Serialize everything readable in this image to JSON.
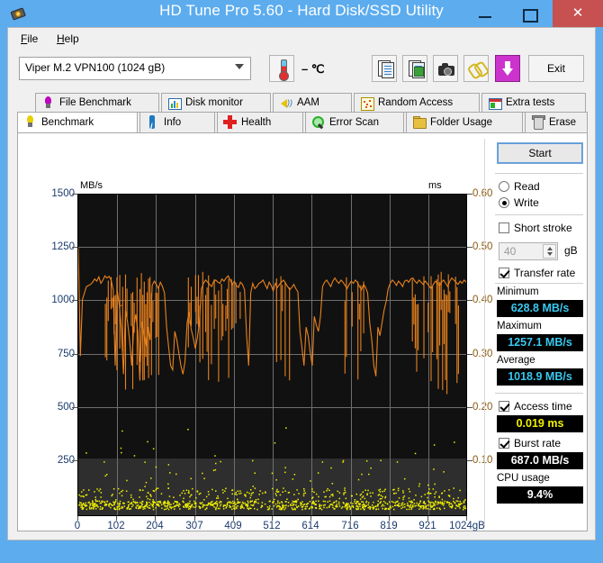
{
  "window": {
    "title": "HD Tune Pro 5.60 - Hard Disk/SSD Utility",
    "app_icon": "hard-disk-icon",
    "minimize": "–",
    "maximize": "▢",
    "close": "✕",
    "titlebar_color": "#5cacee",
    "close_color": "#c75050"
  },
  "menu": {
    "items": [
      {
        "label": "File",
        "accel": "F"
      },
      {
        "label": "Help",
        "accel": "H"
      }
    ]
  },
  "toolbar": {
    "drive": "Viper M.2 VPN100 (1024 gB)",
    "temperature": "– ℃",
    "thermometer_icon": "thermometer-icon",
    "buttons": [
      {
        "name": "copy-text-button",
        "icon": "copy-document-icon"
      },
      {
        "name": "copy-image-button",
        "icon": "copy-image-icon"
      },
      {
        "name": "screenshot-button",
        "icon": "camera-icon"
      },
      {
        "name": "link-button",
        "icon": "chain-link-icon"
      },
      {
        "name": "save-button",
        "icon": "download-arrow-icon",
        "color": "#cc33cc"
      }
    ],
    "exit_label": "Exit"
  },
  "tabs": {
    "top_row": [
      {
        "label": "File Benchmark",
        "icon": "bulb-violet-icon",
        "active": false
      },
      {
        "label": "Disk monitor",
        "icon": "bar-chart-icon",
        "active": false
      },
      {
        "label": "AAM",
        "icon": "speaker-icon",
        "active": false
      },
      {
        "label": "Random Access",
        "icon": "scatter-icon",
        "active": false
      },
      {
        "label": "Extra tests",
        "icon": "table-icon",
        "active": false
      }
    ],
    "bottom_row": [
      {
        "label": "Benchmark",
        "icon": "bulb-yellow-icon",
        "active": true
      },
      {
        "label": "Info",
        "icon": "info-icon",
        "active": false
      },
      {
        "label": "Health",
        "icon": "red-cross-icon",
        "active": false
      },
      {
        "label": "Error Scan",
        "icon": "magnifier-icon",
        "active": false
      },
      {
        "label": "Folder Usage",
        "icon": "folder-icon",
        "active": false
      },
      {
        "label": "Erase",
        "icon": "trash-bin-icon",
        "active": false
      }
    ]
  },
  "controls": {
    "start_label": "Start",
    "mode_read": "Read",
    "mode_write": "Write",
    "mode_selected": "Write",
    "short_stroke_label": "Short stroke",
    "short_stroke_checked": false,
    "short_stroke_value": "40",
    "short_stroke_unit": "gB",
    "transfer_rate_label": "Transfer rate",
    "transfer_rate_checked": true,
    "access_time_label": "Access time",
    "access_time_checked": true,
    "burst_rate_label": "Burst rate",
    "burst_rate_checked": true
  },
  "results": {
    "minimum_label": "Minimum",
    "minimum_value": "628.8 MB/s",
    "maximum_label": "Maximum",
    "maximum_value": "1257.1 MB/s",
    "average_label": "Average",
    "average_value": "1018.9 MB/s",
    "access_time_value": "0.019 ms",
    "burst_rate_value": "687.0 MB/s",
    "cpu_usage_label": "CPU usage",
    "cpu_usage_value": "9.4%"
  },
  "chart_data": {
    "type": "line",
    "title": "",
    "ylabel": "MB/s",
    "y2label": "ms",
    "xlabel": "gB",
    "ylim": [
      0,
      1500
    ],
    "y2lim": [
      0,
      0.6
    ],
    "xlim": [
      0,
      1024
    ],
    "yticks": [
      1500,
      1250,
      1000,
      750,
      500,
      250
    ],
    "y2ticks": [
      "0.60",
      "0.50",
      "0.40",
      "0.30",
      "0.20",
      "0.10"
    ],
    "xticks": [
      "0",
      "102",
      "204",
      "307",
      "409",
      "512",
      "614",
      "716",
      "819",
      "921",
      "1024gB"
    ],
    "grid": true,
    "legend": "none",
    "series": [
      {
        "name": "Transfer rate",
        "color": "#e8821e",
        "axis": "left",
        "units": "MB/s",
        "values": [
          1250,
          745,
          1010,
          1040,
          1070,
          1075,
          1080,
          1090,
          1105,
          1095,
          1115,
          1085,
          1100,
          1120,
          1110,
          1118,
          1100,
          1055,
          700,
          1050,
          980,
          870,
          660,
          960,
          905,
          820,
          700,
          880,
          940,
          860,
          630,
          905,
          845,
          790,
          880,
          820,
          1075,
          1095,
          1080,
          1060,
          1090,
          1070,
          1040,
          880,
          790,
          700,
          680,
          860,
          820,
          760,
          700,
          660,
          720,
          900,
          950,
          870,
          830,
          780,
          830,
          900,
          1060,
          1085,
          1100,
          1090,
          1080,
          1070,
          1095,
          1100,
          1090,
          1085,
          1105,
          1095,
          1110,
          1120,
          1100,
          1080,
          1095,
          1075,
          1065,
          1090,
          1080,
          1055,
          840,
          700,
          1040,
          1085,
          1060,
          1070,
          1085,
          1090,
          1100,
          1080,
          1060,
          1090,
          1075,
          1050,
          1085,
          1065,
          1080,
          1090,
          1100,
          1085,
          1070,
          1055,
          1065,
          1080,
          1060,
          1045,
          860,
          780,
          700,
          880,
          840,
          760,
          700,
          930,
          890,
          860,
          930,
          1070,
          1090,
          1100,
          1085,
          1070,
          1095,
          1110,
          1095,
          1085,
          1100,
          1090,
          1075,
          1060,
          1080,
          1095,
          1085,
          1100,
          1090,
          1070,
          1055,
          1080,
          1065,
          1040,
          900,
          820,
          700,
          650,
          880,
          840,
          900,
          960,
          1000,
          1060,
          1085,
          1100,
          1090,
          1075,
          1095,
          1085,
          1070,
          1095,
          1100,
          1090,
          1105,
          1110,
          1095,
          1085,
          1100,
          1090,
          1080,
          1095,
          1085,
          1070,
          1060,
          1080,
          1095,
          1085,
          1075,
          1090,
          1100,
          1085,
          1070,
          1095,
          1110,
          1100,
          1090,
          1080,
          1095,
          1085,
          1100,
          1090
        ]
      },
      {
        "name": "Access time",
        "color": "#f0f000",
        "axis": "right",
        "units": "ms",
        "marker": "dot",
        "description": "Dense cluster of yellow dots near 0.015-0.035 ms along the baseline with scattered outliers up to ~0.16 ms"
      }
    ]
  }
}
